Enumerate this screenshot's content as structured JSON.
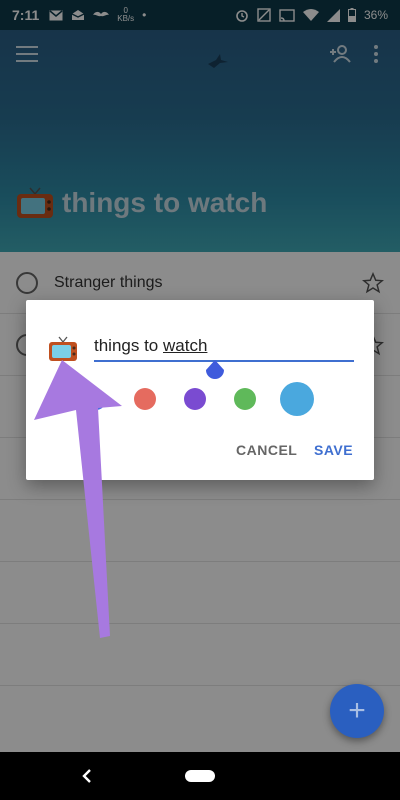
{
  "status_bar": {
    "time": "7:11",
    "kbs_value": "0",
    "kbs_unit": "KB/s",
    "battery": "36%"
  },
  "header": {
    "list_title": "things to watch",
    "list_emoji": "tv-emoji"
  },
  "list": {
    "items": [
      {
        "label": "Stranger things"
      }
    ]
  },
  "dialog": {
    "input_text_plain": "things to ",
    "input_text_underlined": "watch",
    "swatches": [
      {
        "name": "blue",
        "color": "#4c6ee0"
      },
      {
        "name": "red",
        "color": "#e56b5f"
      },
      {
        "name": "purple",
        "color": "#7a4bd1"
      },
      {
        "name": "green",
        "color": "#5fb95a"
      },
      {
        "name": "light-blue",
        "color": "#4aa8de"
      }
    ],
    "cancel_label": "CANCEL",
    "save_label": "SAVE"
  },
  "colors": {
    "accent": "#3f6fd0",
    "arrow": "#a779e0"
  }
}
